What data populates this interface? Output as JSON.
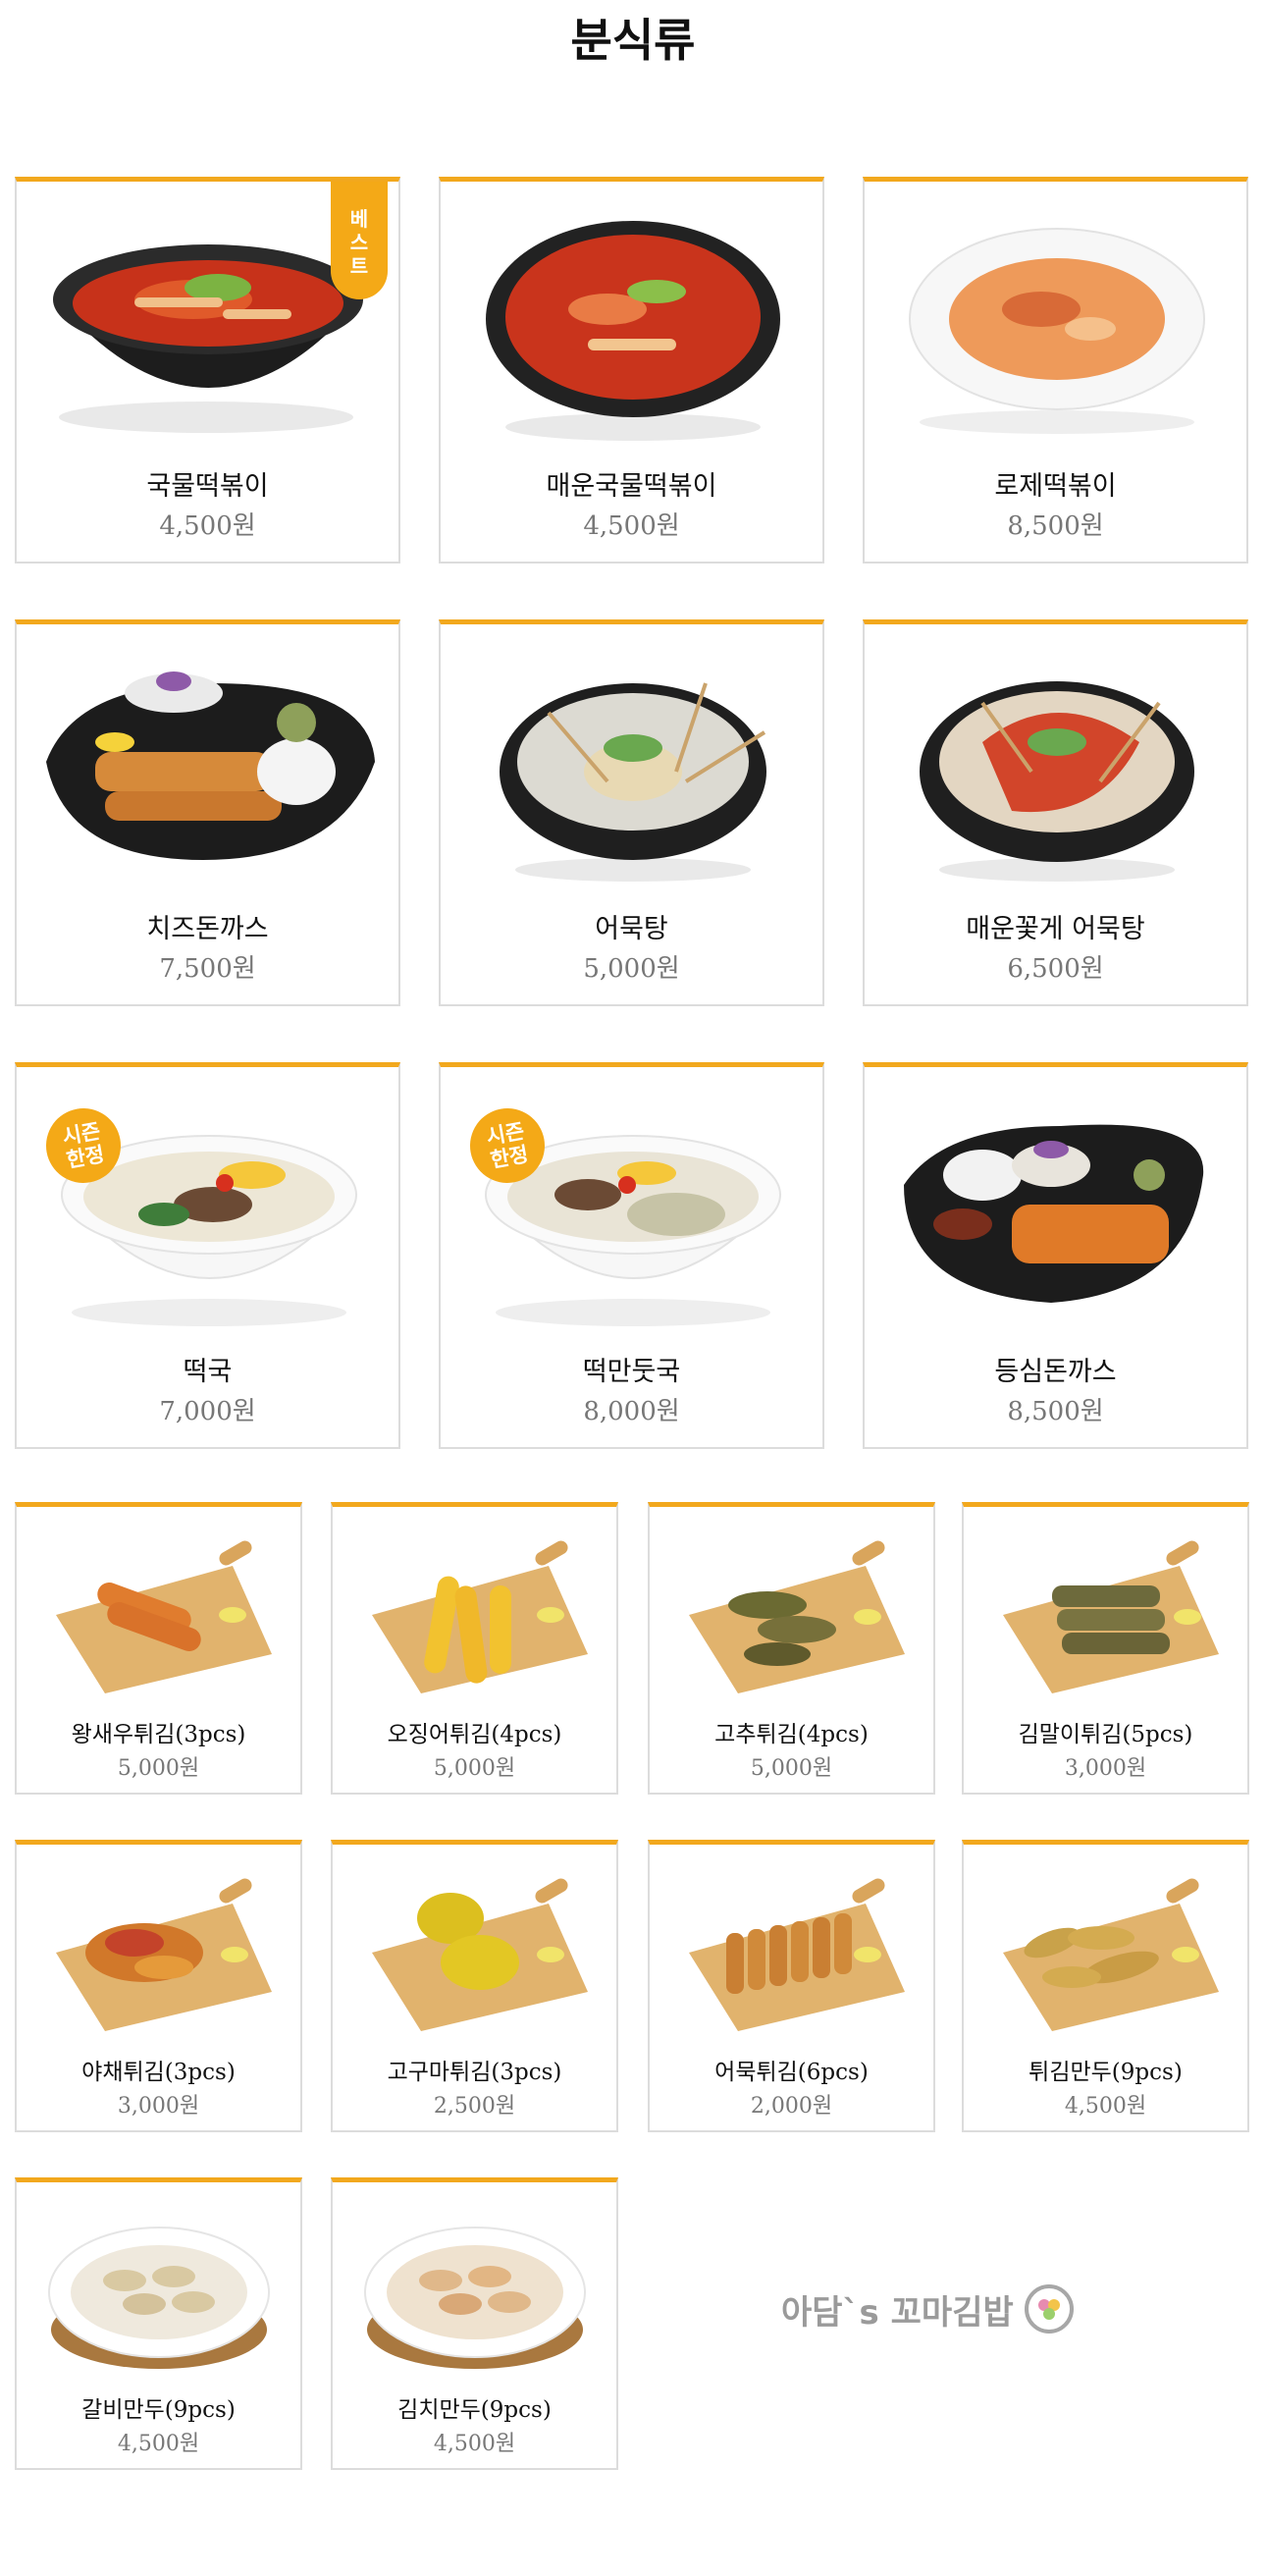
{
  "page": {
    "title": "분식류"
  },
  "badges": {
    "best": [
      "베",
      "스",
      "트"
    ],
    "season": [
      "시즌",
      "한정"
    ]
  },
  "menu": [
    {
      "name": "국물떡볶이",
      "price": "4,500원"
    },
    {
      "name": "매운국물떡볶이",
      "price": "4,500원"
    },
    {
      "name": "로제떡볶이",
      "price": "8,500원"
    },
    {
      "name": "치즈돈까스",
      "price": "7,500원"
    },
    {
      "name": "어묵탕",
      "price": "5,000원"
    },
    {
      "name": "매운꽃게 어묵탕",
      "price": "6,500원"
    },
    {
      "name": "떡국",
      "price": "7,000원"
    },
    {
      "name": "떡만둣국",
      "price": "8,000원"
    },
    {
      "name": "등심돈까스",
      "price": "8,500원"
    },
    {
      "name": "왕새우튀김(3pcs)",
      "price": "5,000원"
    },
    {
      "name": "오징어튀김(4pcs)",
      "price": "5,000원"
    },
    {
      "name": "고추튀김(4pcs)",
      "price": "5,000원"
    },
    {
      "name": "김말이튀김(5pcs)",
      "price": "3,000원"
    },
    {
      "name": "야채튀김(3pcs)",
      "price": "3,000원"
    },
    {
      "name": "고구마튀김(3pcs)",
      "price": "2,500원"
    },
    {
      "name": "어묵튀김(6pcs)",
      "price": "2,000원"
    },
    {
      "name": "튀김만두(9pcs)",
      "price": "4,500원"
    },
    {
      "name": "갈비만두(9pcs)",
      "price": "4,500원"
    },
    {
      "name": "김치만두(9pcs)",
      "price": "4,500원"
    }
  ],
  "brand": {
    "text": "아담`s 꼬마김밥"
  },
  "colors": {
    "accent": "#f2a81d",
    "border": "#dcdcdc",
    "price": "#777777"
  }
}
